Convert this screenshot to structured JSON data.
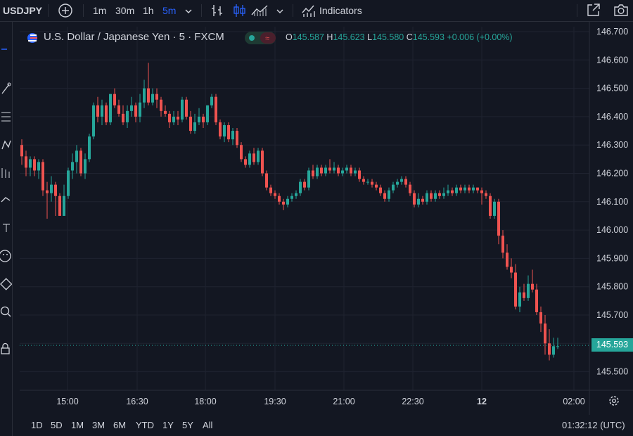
{
  "toolbar": {
    "symbol": "USDJPY",
    "intervals": [
      "1m",
      "30m",
      "1h",
      "5m"
    ],
    "active_interval": "5m",
    "indicators_label": "Indicators",
    "icons": [
      "add-symbol-icon",
      "chevron-down-icon",
      "bar-chart-icon",
      "candles-icon",
      "area-chart-icon",
      "indicators-icon",
      "fullscreen-icon",
      "camera-icon"
    ]
  },
  "legend": {
    "title": "U.S. Dollar / Japanese Yen · 5 · FXCM",
    "open_label": "O",
    "open": "145.587",
    "high_label": "H",
    "high": "145.623",
    "low_label": "L",
    "low": "145.580",
    "close_label": "C",
    "close": "145.593",
    "change": "+0.006 (+0.00%)",
    "up_color": "#26a69a",
    "down_color": "#ef5350"
  },
  "price_badge": "145.593",
  "ranges": [
    "1D",
    "5D",
    "1M",
    "3M",
    "6M",
    "YTD",
    "1Y",
    "5Y",
    "All"
  ],
  "clock": "01:32:12 (UTC)",
  "chart_data": {
    "type": "candlestick",
    "title": "U.S. Dollar / Japanese Yen · 5 · FXCM",
    "x_tick_labels": [
      "15:00",
      "16:30",
      "18:00",
      "19:30",
      "21:00",
      "22:30",
      "12",
      "02:00"
    ],
    "y_tick_labels": [
      "146.700",
      "146.600",
      "146.500",
      "146.400",
      "146.300",
      "146.200",
      "146.100",
      "146.000",
      "145.900",
      "145.800",
      "145.700",
      "145.600",
      "145.500"
    ],
    "ylim": [
      145.45,
      146.72
    ],
    "grid": true,
    "last_price": 145.593,
    "series": [
      {
        "values": [
          [
            146.3,
            146.26,
            146.32,
            146.23
          ],
          [
            146.26,
            146.22,
            146.28,
            146.19
          ],
          [
            146.22,
            146.25,
            146.26,
            146.19
          ],
          [
            146.25,
            146.21,
            146.26,
            146.19
          ],
          [
            146.21,
            146.24,
            146.25,
            146.18
          ],
          [
            146.24,
            146.14,
            146.25,
            146.12
          ],
          [
            146.14,
            146.13,
            146.17,
            146.04
          ],
          [
            146.13,
            146.16,
            146.19,
            146.1
          ],
          [
            146.16,
            146.12,
            146.17,
            146.05
          ],
          [
            146.12,
            146.05,
            146.13,
            146.05
          ],
          [
            146.05,
            146.12,
            146.16,
            146.05
          ],
          [
            146.12,
            146.21,
            146.22,
            146.11
          ],
          [
            146.21,
            146.24,
            146.27,
            146.18
          ],
          [
            146.24,
            146.28,
            146.3,
            146.2
          ],
          [
            146.28,
            146.2,
            146.29,
            146.19
          ],
          [
            146.2,
            146.25,
            146.27,
            146.18
          ],
          [
            146.25,
            146.33,
            146.34,
            146.24
          ],
          [
            146.33,
            146.44,
            146.45,
            146.32
          ],
          [
            146.44,
            146.4,
            146.47,
            146.38
          ],
          [
            146.4,
            146.44,
            146.46,
            146.37
          ],
          [
            146.44,
            146.38,
            146.45,
            146.37
          ],
          [
            146.38,
            146.48,
            146.48,
            146.37
          ],
          [
            146.48,
            146.44,
            146.5,
            146.43
          ],
          [
            146.44,
            146.41,
            146.46,
            146.4
          ],
          [
            146.41,
            146.38,
            146.44,
            146.37
          ],
          [
            146.38,
            146.42,
            146.44,
            146.36
          ],
          [
            146.42,
            146.44,
            146.47,
            146.4
          ],
          [
            146.44,
            146.4,
            146.45,
            146.38
          ],
          [
            146.4,
            146.45,
            146.48,
            146.38
          ],
          [
            146.45,
            146.5,
            146.53,
            146.43
          ],
          [
            146.5,
            146.45,
            146.59,
            146.44
          ],
          [
            146.45,
            146.48,
            146.5,
            146.44
          ],
          [
            146.48,
            146.46,
            146.5,
            146.43
          ],
          [
            146.46,
            146.42,
            146.47,
            146.4
          ],
          [
            146.42,
            146.41,
            146.44,
            146.4
          ],
          [
            146.41,
            146.38,
            146.42,
            146.36
          ],
          [
            146.38,
            146.4,
            146.42,
            146.37
          ],
          [
            146.4,
            146.39,
            146.42,
            146.37
          ],
          [
            146.39,
            146.46,
            146.47,
            146.38
          ],
          [
            146.46,
            146.4,
            146.47,
            146.39
          ],
          [
            146.4,
            146.35,
            146.42,
            146.34
          ],
          [
            146.35,
            146.38,
            146.41,
            146.34
          ],
          [
            146.38,
            146.4,
            146.43,
            146.37
          ],
          [
            146.4,
            146.38,
            146.41,
            146.36
          ],
          [
            146.38,
            146.44,
            146.44,
            146.37
          ],
          [
            146.44,
            146.47,
            146.48,
            146.43
          ],
          [
            146.47,
            146.38,
            146.48,
            146.37
          ],
          [
            146.38,
            146.33,
            146.39,
            146.32
          ],
          [
            146.33,
            146.37,
            146.38,
            146.31
          ],
          [
            146.37,
            146.32,
            146.38,
            146.31
          ],
          [
            146.32,
            146.35,
            146.36,
            146.3
          ],
          [
            146.35,
            146.3,
            146.36,
            146.29
          ],
          [
            146.3,
            146.25,
            146.31,
            146.24
          ],
          [
            146.25,
            146.23,
            146.26,
            146.22
          ],
          [
            146.23,
            146.27,
            146.28,
            146.22
          ],
          [
            146.27,
            146.24,
            146.29,
            146.23
          ],
          [
            146.24,
            146.28,
            146.29,
            146.23
          ],
          [
            146.28,
            146.2,
            146.29,
            146.19
          ],
          [
            146.2,
            146.15,
            146.21,
            146.14
          ],
          [
            146.15,
            146.13,
            146.16,
            146.12
          ],
          [
            146.13,
            146.12,
            146.14,
            146.11
          ],
          [
            146.12,
            146.1,
            146.13,
            146.09
          ],
          [
            146.1,
            146.09,
            146.11,
            146.07
          ],
          [
            146.09,
            146.11,
            146.12,
            146.08
          ],
          [
            146.11,
            146.12,
            146.13,
            146.1
          ],
          [
            146.12,
            146.13,
            146.14,
            146.11
          ],
          [
            146.13,
            146.17,
            146.18,
            146.12
          ],
          [
            146.17,
            146.15,
            146.18,
            146.14
          ],
          [
            146.15,
            146.21,
            146.22,
            146.14
          ],
          [
            146.21,
            146.19,
            146.23,
            146.18
          ],
          [
            146.19,
            146.22,
            146.23,
            146.18
          ],
          [
            146.22,
            146.2,
            146.23,
            146.19
          ],
          [
            146.2,
            146.22,
            146.23,
            146.19
          ],
          [
            146.22,
            146.21,
            146.25,
            146.2
          ],
          [
            146.21,
            146.22,
            146.24,
            146.2
          ],
          [
            146.22,
            146.2,
            146.23,
            146.19
          ],
          [
            146.2,
            146.21,
            146.22,
            146.19
          ],
          [
            146.21,
            146.22,
            146.23,
            146.2
          ],
          [
            146.22,
            146.2,
            146.23,
            146.19
          ],
          [
            146.2,
            146.21,
            146.22,
            146.19
          ],
          [
            146.21,
            146.18,
            146.22,
            146.17
          ],
          [
            146.18,
            146.17,
            146.19,
            146.16
          ],
          [
            146.17,
            146.17,
            146.18,
            146.16
          ],
          [
            146.17,
            146.16,
            146.18,
            146.15
          ],
          [
            146.16,
            146.15,
            146.17,
            146.14
          ],
          [
            146.15,
            146.13,
            146.16,
            146.12
          ],
          [
            146.13,
            146.11,
            146.14,
            146.1
          ],
          [
            146.11,
            146.14,
            146.15,
            146.1
          ],
          [
            146.14,
            146.16,
            146.17,
            146.13
          ],
          [
            146.16,
            146.17,
            146.18,
            146.15
          ],
          [
            146.17,
            146.18,
            146.19,
            146.16
          ],
          [
            146.18,
            146.16,
            146.19,
            146.15
          ],
          [
            146.16,
            146.13,
            146.17,
            146.12
          ],
          [
            146.13,
            146.09,
            146.14,
            146.08
          ],
          [
            146.09,
            146.11,
            146.13,
            146.08
          ],
          [
            146.11,
            146.1,
            146.12,
            146.09
          ],
          [
            146.1,
            146.13,
            146.14,
            146.09
          ],
          [
            146.13,
            146.11,
            146.14,
            146.1
          ],
          [
            146.11,
            146.13,
            146.14,
            146.1
          ],
          [
            146.13,
            146.12,
            146.14,
            146.11
          ],
          [
            146.12,
            146.13,
            146.15,
            146.11
          ],
          [
            146.13,
            146.14,
            146.16,
            146.12
          ],
          [
            146.14,
            146.13,
            146.15,
            146.12
          ],
          [
            146.13,
            146.15,
            146.16,
            146.12
          ],
          [
            146.15,
            146.14,
            146.16,
            146.13
          ],
          [
            146.14,
            146.15,
            146.16,
            146.13
          ],
          [
            146.15,
            146.14,
            146.16,
            146.13
          ],
          [
            146.14,
            146.15,
            146.16,
            146.13
          ],
          [
            146.15,
            146.14,
            146.15,
            146.13
          ],
          [
            146.14,
            146.13,
            146.15,
            146.09
          ],
          [
            146.13,
            146.12,
            146.14,
            146.11
          ],
          [
            146.12,
            146.05,
            146.13,
            146.04
          ],
          [
            146.05,
            146.1,
            146.11,
            146.04
          ],
          [
            146.1,
            145.98,
            146.11,
            145.95
          ],
          [
            145.98,
            145.92,
            146.0,
            145.9
          ],
          [
            145.92,
            145.87,
            145.95,
            145.86
          ],
          [
            145.87,
            145.85,
            145.9,
            145.83
          ],
          [
            145.85,
            145.73,
            145.88,
            145.72
          ],
          [
            145.73,
            145.78,
            145.8,
            145.71
          ],
          [
            145.78,
            145.76,
            145.81,
            145.75
          ],
          [
            145.76,
            145.81,
            145.84,
            145.75
          ],
          [
            145.81,
            145.79,
            145.86,
            145.78
          ],
          [
            145.79,
            145.71,
            145.81,
            145.7
          ],
          [
            145.71,
            145.67,
            145.73,
            145.64
          ],
          [
            145.67,
            145.6,
            145.7,
            145.56
          ],
          [
            145.6,
            145.56,
            145.65,
            145.54
          ],
          [
            145.56,
            145.59,
            145.62,
            145.55
          ],
          [
            145.59,
            145.59,
            145.62,
            145.58
          ]
        ]
      }
    ]
  }
}
